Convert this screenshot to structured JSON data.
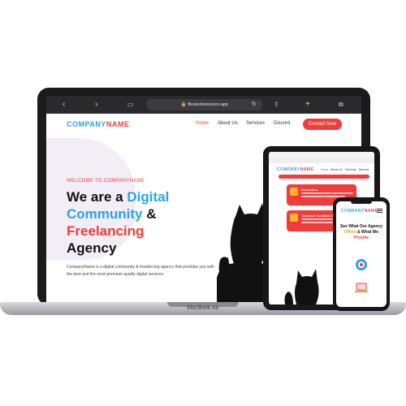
{
  "laptop": {
    "model_label": "MacBook Air",
    "browser": {
      "url_prefix": "aA",
      "url": "🔒 flexisolvesource.app",
      "icons": [
        "chevron-left-icon",
        "chevron-right-icon",
        "book-icon",
        "reload-icon",
        "share-icon",
        "plus-icon",
        "tabs-icon"
      ]
    },
    "site": {
      "logo_part1": "COMPANY",
      "logo_part2": "NAME",
      "nav": [
        "Home",
        "About Us",
        "Services",
        "Discord"
      ],
      "contact_button": "Contact Now",
      "welcome": "WELCOME TO COMPANYNAME",
      "headline_line1_plain": "We are a ",
      "headline_line1_highlight": "Digital",
      "headline_line2_highlight": "Community",
      "headline_line2_plain": " &",
      "headline_line3_highlight": "Freelancing",
      "headline_line4_plain": "Agency",
      "description": "CompanyName is a digital community & freelancing agency that provides you with the best and the most premium quality digital services."
    }
  },
  "tablet": {
    "logo_part1": "COMPANY",
    "logo_part2": "NAME",
    "nav": [
      "Home",
      "About Us",
      "Services",
      "Discord"
    ],
    "cards": [
      {
        "title": "Innovation"
      },
      {
        "title": "Customer Satisfaction"
      }
    ]
  },
  "phone": {
    "logo_part1": "COMPANY",
    "logo_part2": "NAME",
    "heading_line1": "See What Our Agency",
    "heading_line2_hl": "Offers",
    "heading_line2_plain": " & What We",
    "heading_line3_hl": "Provide"
  },
  "colors": {
    "accent_blue": "#2aa3e6",
    "accent_red": "#f23c3c",
    "device_black": "#1b1b1d"
  }
}
